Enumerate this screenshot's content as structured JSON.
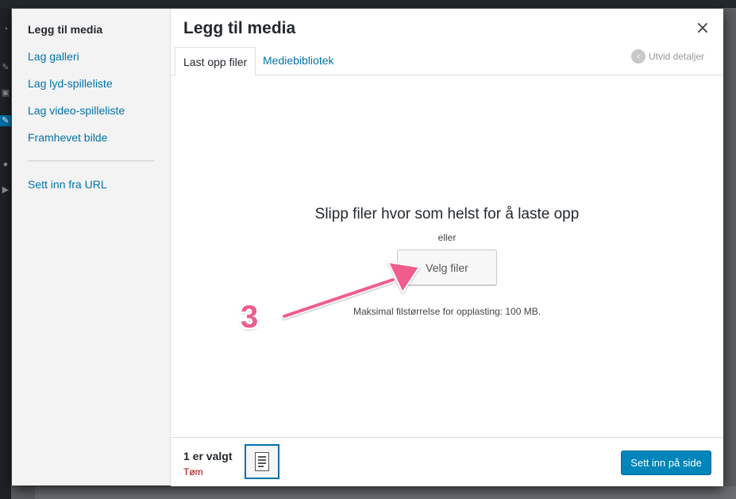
{
  "menu": {
    "items": [
      {
        "label": "Legg til media",
        "active": true
      },
      {
        "label": "Lag galleri"
      },
      {
        "label": "Lag lyd-spilleliste"
      },
      {
        "label": "Lag video-spilleliste"
      },
      {
        "label": "Framhevet bilde"
      },
      {
        "label": "Sett inn fra URL"
      }
    ]
  },
  "frame": {
    "title": "Legg til media",
    "close_icon": "×"
  },
  "tabs": [
    {
      "label": "Last opp filer",
      "active": true
    },
    {
      "label": "Mediebibliotek"
    }
  ],
  "expand_details": {
    "label": "Utvid detaljer",
    "icon": "chevron-left-icon"
  },
  "upload": {
    "drop_title": "Slipp filer hvor som helst for å laste opp",
    "or": "eller",
    "select_button": "Velg filer",
    "max_size": "Maksimal filstørrelse for opplasting: 100 MB."
  },
  "toolbar": {
    "selection_count": "1 er valgt",
    "clear_label": "Tøm",
    "insert_button": "Sett inn på side"
  },
  "annotation": {
    "number": "3",
    "color": "#f05c8c"
  },
  "colors": {
    "accent": "#0073aa",
    "primary_button": "#0085ba",
    "clear_link": "#aa0000"
  }
}
